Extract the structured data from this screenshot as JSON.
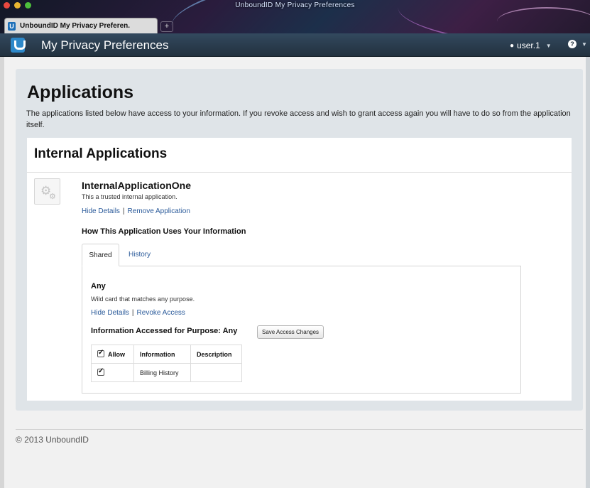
{
  "window": {
    "title": "UnboundID My Privacy Preferences",
    "tab_title": "UnboundID My Privacy Preferen..."
  },
  "navbar": {
    "brand": "My Privacy Preferences",
    "user": "user.1",
    "user_icon": "user-icon",
    "help_icon": "help-icon"
  },
  "page": {
    "title": "Applications",
    "description": "The applications listed below have access to your information. If you revoke access and wish to grant access again you will have to do so from the application itself."
  },
  "section": {
    "title": "Internal Applications"
  },
  "application": {
    "icon": "gears-icon",
    "name": "InternalApplicationOne",
    "description": "This a trusted internal application.",
    "hide_details": "Hide Details",
    "remove": "Remove Application",
    "how_title": "How This Application Uses Your Information",
    "tabs": [
      "Shared",
      "History"
    ],
    "active_tab": "Shared"
  },
  "purpose": {
    "name": "Any",
    "description": "Wild card that matches any purpose.",
    "hide_details": "Hide Details",
    "revoke": "Revoke Access",
    "access_title": "Information Accessed for Purpose: Any",
    "save_button": "Save Access Changes",
    "table": {
      "headers": [
        "Allow",
        "Information",
        "Description"
      ],
      "rows": [
        {
          "allow": true,
          "information": "Billing History",
          "description": ""
        }
      ]
    }
  },
  "footer": {
    "copyright": "© 2013 UnboundID"
  },
  "colors": {
    "navbar": "#2a3c4f",
    "link": "#2a5a9a",
    "well": "#dfe4e8",
    "brand_logo": "#2d88c9"
  }
}
